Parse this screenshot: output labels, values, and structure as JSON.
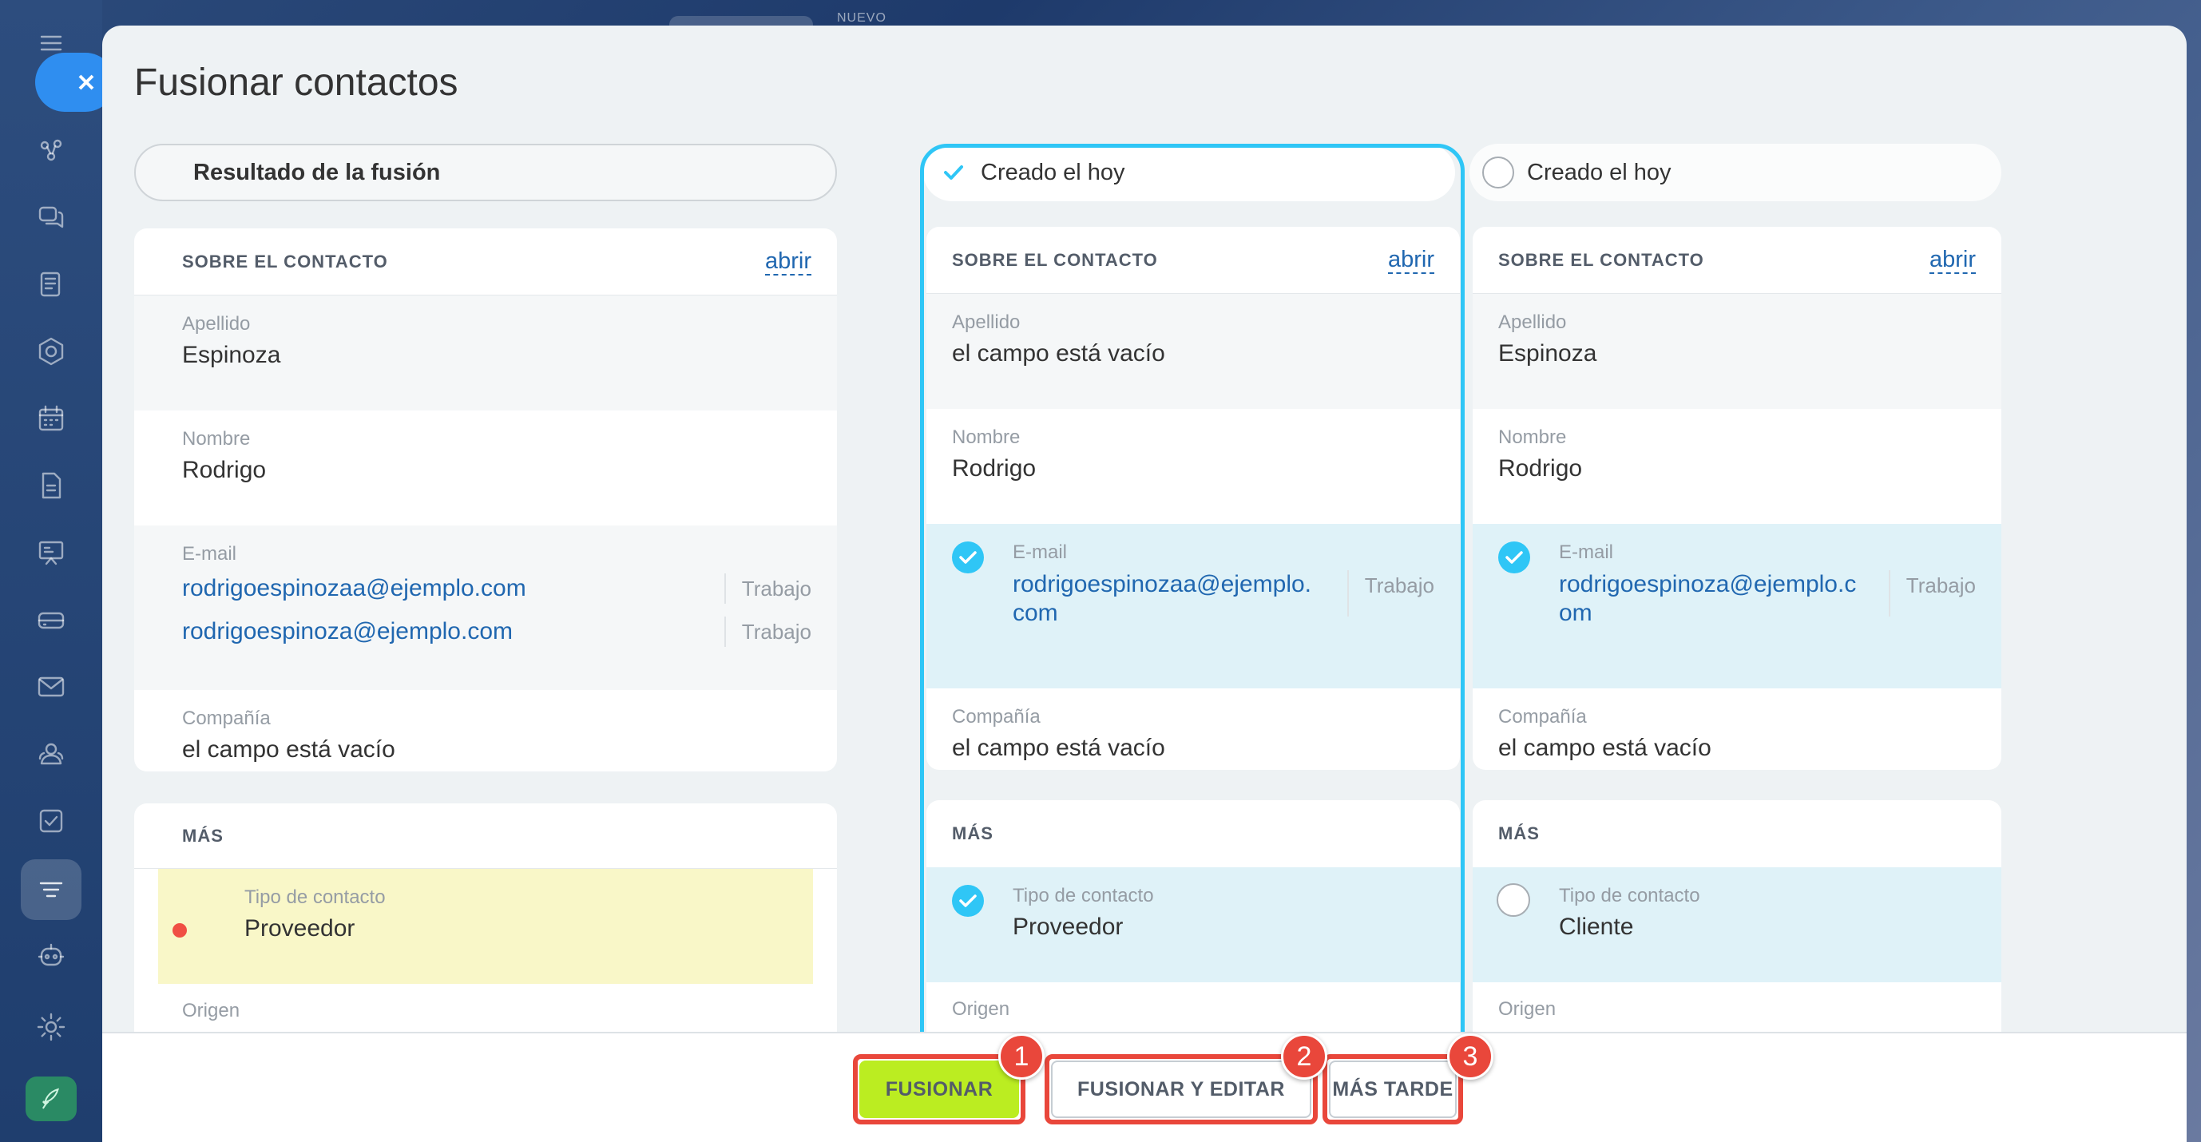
{
  "background": {
    "top_label": "NUEVO"
  },
  "modal": {
    "title": "Fusionar contactos",
    "result_label": "Resultado de la fusión",
    "columns": [
      {
        "label": "Creado el hoy",
        "selected": true
      },
      {
        "label": "Creado el hoy",
        "selected": false
      }
    ]
  },
  "result": {
    "about": {
      "section": "SOBRE EL CONTACTO",
      "open": "abrir",
      "apellido_label": "Apellido",
      "apellido_value": "Espinoza",
      "nombre_label": "Nombre",
      "nombre_value": "Rodrigo",
      "email_label": "E-mail",
      "emails": [
        {
          "address": "rodrigoespinozaa@ejemplo.com",
          "type": "Trabajo"
        },
        {
          "address": "rodrigoespinoza@ejemplo.com",
          "type": "Trabajo"
        }
      ],
      "compania_label": "Compañía",
      "compania_value": "el campo está vacío"
    },
    "mas": {
      "section": "MÁS",
      "tipo_label": "Tipo de contacto",
      "tipo_value": "Proveedor",
      "origen_label": "Origen"
    }
  },
  "source1": {
    "about": {
      "section": "SOBRE EL CONTACTO",
      "open": "abrir",
      "apellido_label": "Apellido",
      "apellido_value": "el campo está vacío",
      "nombre_label": "Nombre",
      "nombre_value": "Rodrigo",
      "email_label": "E-mail",
      "email_line1": "rodrigoespinozaa@ejemplo.",
      "email_line2": "com",
      "email_type": "Trabajo",
      "compania_label": "Compañía",
      "compania_value": "el campo está vacío"
    },
    "mas": {
      "section": "MÁS",
      "tipo_label": "Tipo de contacto",
      "tipo_value": "Proveedor",
      "origen_label": "Origen"
    }
  },
  "source2": {
    "about": {
      "section": "SOBRE EL CONTACTO",
      "open": "abrir",
      "apellido_label": "Apellido",
      "apellido_value": "Espinoza",
      "nombre_label": "Nombre",
      "nombre_value": "Rodrigo",
      "email_label": "E-mail",
      "email_line1": "rodrigoespinoza@ejemplo.c",
      "email_line2": "om",
      "email_type": "Trabajo",
      "compania_label": "Compañía",
      "compania_value": "el campo está vacío"
    },
    "mas": {
      "section": "MÁS",
      "tipo_label": "Tipo de contacto",
      "tipo_value": "Cliente",
      "origen_label": "Origen"
    }
  },
  "actions": {
    "merge": "FUSIONAR",
    "merge_edit": "FUSIONAR Y EDITAR",
    "later": "MÁS TARDE",
    "badges": [
      "1",
      "2",
      "3"
    ]
  },
  "colors": {
    "accent": "#2fc6f6",
    "merge_button": "#bbed21",
    "annotation": "#e9473b",
    "link": "#2067b0"
  },
  "icons": [
    "menu-icon",
    "close-icon",
    "activity-icon",
    "chat-icon",
    "feed-icon",
    "hexagon-icon",
    "calendar-icon",
    "document-icon",
    "board-icon",
    "drive-icon",
    "mail-icon",
    "contacts-icon",
    "tasks-icon",
    "crm-icon",
    "robot-icon",
    "settings-icon",
    "rocket-icon",
    "check-icon"
  ]
}
